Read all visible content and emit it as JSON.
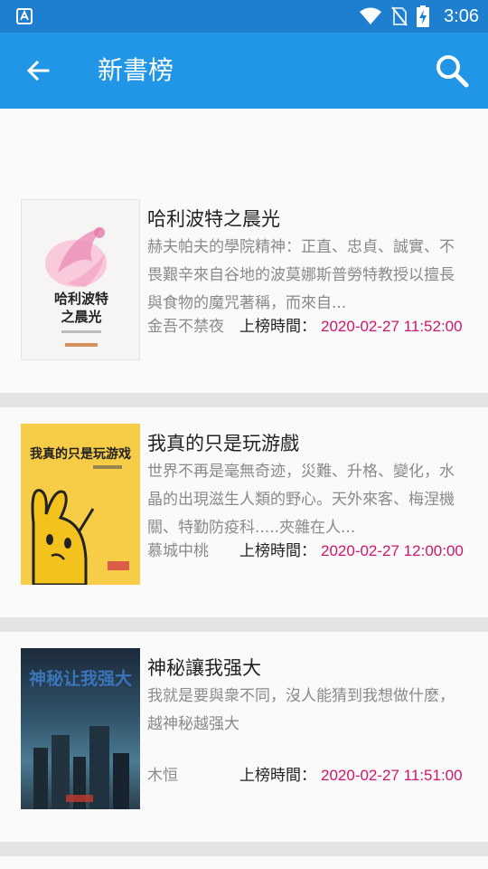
{
  "status_bar": {
    "time": "3:06"
  },
  "app_bar": {
    "title": "新書榜"
  },
  "books": [
    {
      "title": "哈利波特之晨光",
      "description": "赫夫帕夫的學院精神：正直、忠貞、誠實、不畏艱辛來自谷地的波莫娜斯普勞特教授以擅長與食物的魔咒著稱，而來自...",
      "author": "金吾不禁夜",
      "listed_label": "上榜時間：",
      "listed_time": "2020-02-27 11:52:00",
      "cover_text": "哈利波特之晨光"
    },
    {
      "title": "我真的只是玩游戲",
      "description": "世界不再是毫無奇迹，災難、升格、變化，水晶的出現滋生人類的野心。天外來客、梅涅機關、特勤防疫科.....夾雜在人...",
      "author": "慕城中桃",
      "listed_label": "上榜時間：",
      "listed_time": "2020-02-27 12:00:00",
      "cover_text": "我真的只是玩游戏"
    },
    {
      "title": "神秘讓我强大",
      "description": "我就是要與衆不同，沒人能猜到我想做什麽，越神秘越强大",
      "author": "木恒",
      "listed_label": "上榜時間：",
      "listed_time": "2020-02-27 11:51:00",
      "cover_text": "神秘让我强大"
    }
  ],
  "colors": {
    "status_bar": "#1e7fd0",
    "app_bar": "#2196e6",
    "time_accent": "#d0166a"
  },
  "icons": {
    "back": "arrow-left-icon",
    "search": "search-icon",
    "wifi": "wifi-icon",
    "no_sim": "no-sim-icon",
    "battery": "battery-charging-icon"
  }
}
